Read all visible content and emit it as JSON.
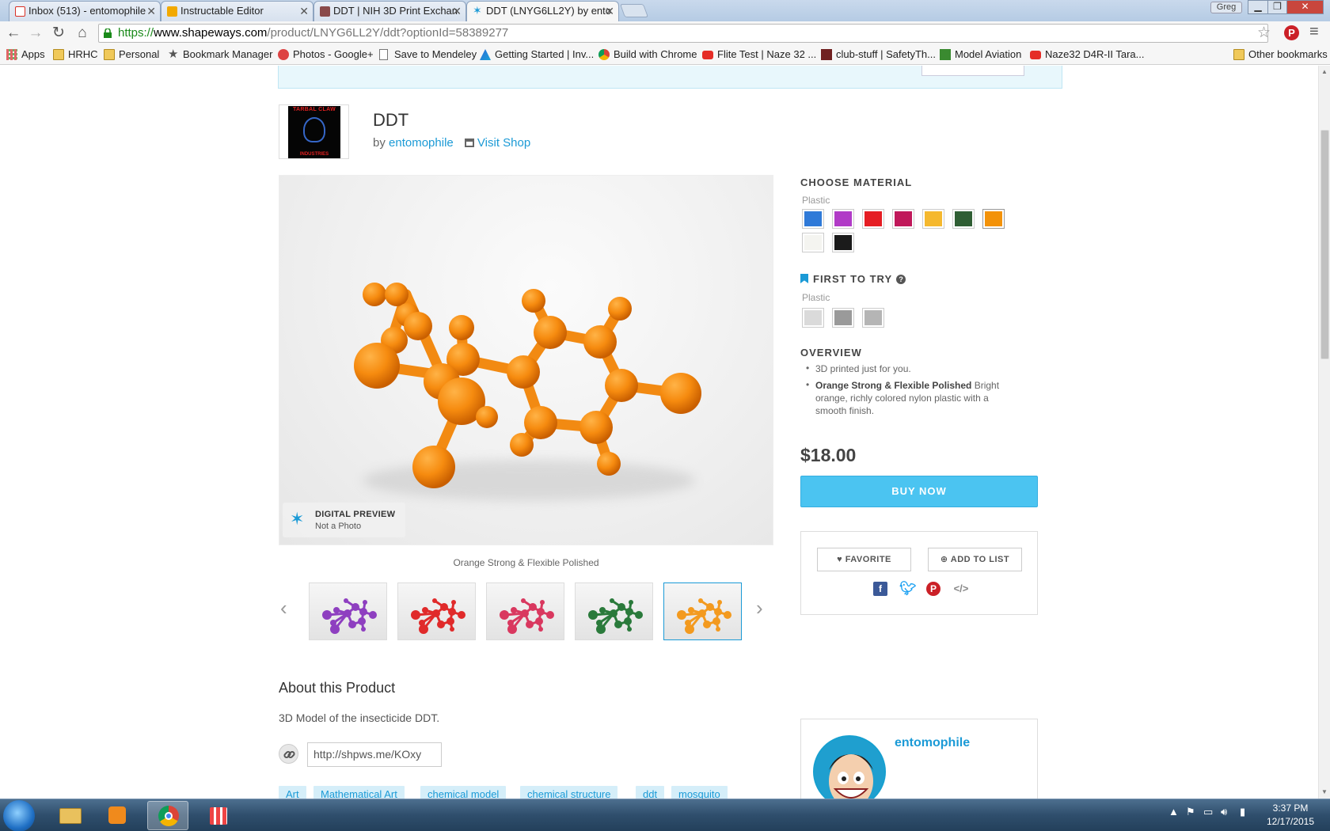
{
  "browser": {
    "tabs": [
      {
        "title": "Inbox (513) - entomophile",
        "icon_color": "#d93025"
      },
      {
        "title": "Instructable Editor",
        "icon_color": "#f2a900"
      },
      {
        "title": "DDT | NIH 3D Print Exchan",
        "icon_color": "#8a4a4a"
      },
      {
        "title": "DDT (LNYG6LL2Y) by ento",
        "icon_color": "#1b9ad6"
      }
    ],
    "profile_name": "Greg",
    "url_scheme": "https://",
    "url_host": "www.shapeways.com",
    "url_path": "/product/LNYG6LL2Y/ddt?optionId=58389277",
    "bookmarks": [
      {
        "label": "Apps",
        "icon": "apps-grid-icon"
      },
      {
        "label": "HRHC",
        "icon": "folder-icon"
      },
      {
        "label": "Personal",
        "icon": "folder-icon"
      },
      {
        "label": "Bookmark Manager",
        "icon": "star-icon"
      },
      {
        "label": "Photos - Google+",
        "icon": "google-plus-icon"
      },
      {
        "label": "Save to Mendeley",
        "icon": "page-icon"
      },
      {
        "label": "Getting Started | Inv...",
        "icon": "a-icon"
      },
      {
        "label": "Build with Chrome",
        "icon": "chrome-icon"
      },
      {
        "label": "Flite Test | Naze 32 ...",
        "icon": "youtube-icon"
      },
      {
        "label": "club-stuff | SafetyTh...",
        "icon": "site-icon"
      },
      {
        "label": "Model Aviation",
        "icon": "site-icon"
      },
      {
        "label": "Naze32 D4R-II Tara...",
        "icon": "youtube-icon"
      }
    ],
    "other_bookmarks": "Other bookmarks"
  },
  "product": {
    "title": "DDT",
    "by_prefix": "by",
    "author": "entomophile",
    "visit_shop": "Visit Shop",
    "shop_logo_top": "TARBAL CLAW",
    "shop_logo_bottom": "INDUSTRIES",
    "preview_badge_title": "DIGITAL PREVIEW",
    "preview_badge_sub": "Not a Photo",
    "caption": "Orange Strong & Flexible Polished",
    "thumbnails": [
      {
        "color": "#8e3fc0"
      },
      {
        "color": "#e02a2a"
      },
      {
        "color": "#d9385f"
      },
      {
        "color": "#2a7a3b"
      },
      {
        "color": "#f39a1f"
      }
    ],
    "about_heading": "About this Product",
    "about_text": "3D Model of the insecticide DDT.",
    "short_link": "http://shpws.me/KOxy",
    "tags": [
      "Art",
      "Mathematical Art",
      "chemical model",
      "chemical structure",
      "ddt",
      "mosquito"
    ]
  },
  "purchase": {
    "choose_material": "CHOOSE MATERIAL",
    "plastic_label": "Plastic",
    "material_swatches": [
      "#2f7ad8",
      "#b13bc7",
      "#e51d23",
      "#c0185a",
      "#f5b82e",
      "#2f5e34",
      "#f39209",
      "#f4f4f0",
      "#1b1b1b"
    ],
    "selected_swatch": 6,
    "first_to_try": "FIRST TO TRY",
    "first_plastic_label": "Plastic",
    "first_swatches": [
      "#dadada",
      "#9a9a9a",
      "#b5b5b5"
    ],
    "overview_heading": "OVERVIEW",
    "overview_item1": "3D printed just for you.",
    "overview_item2_bold": "Orange Strong & Flexible Polished",
    "overview_item2_rest": " Bright orange, richly colored nylon plastic with a smooth finish.",
    "price": "$18.00",
    "buy_now": "BUY NOW",
    "favorite": "FAVORITE",
    "add_to_list": "ADD TO LIST",
    "seller_name": "entomophile"
  },
  "taskbar": {
    "time": "3:37 PM",
    "date": "12/17/2015"
  }
}
